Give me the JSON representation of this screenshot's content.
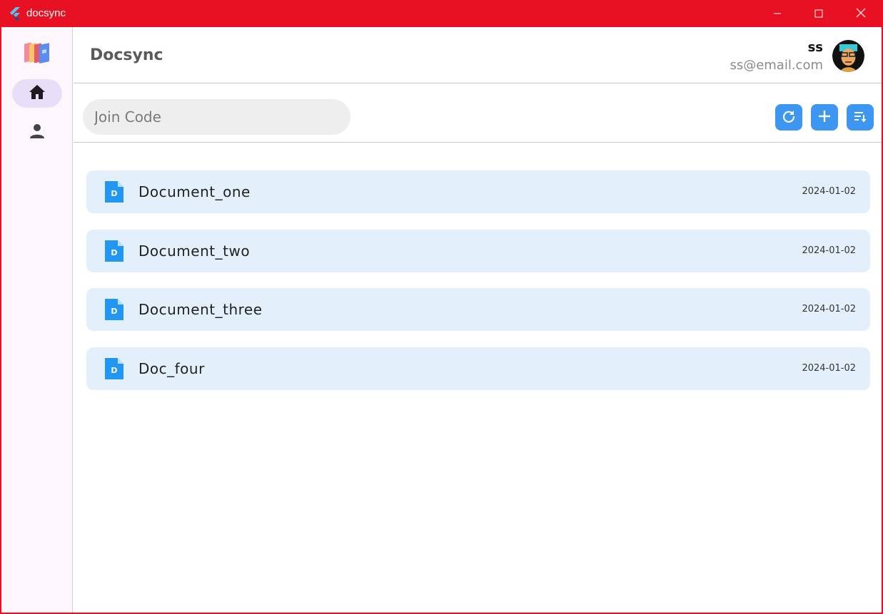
{
  "window": {
    "title": "docsync",
    "controls": {
      "minimize_icon": "minimize-icon",
      "maximize_icon": "maximize-icon",
      "close_icon": "close-icon"
    },
    "accent": "#e81123"
  },
  "rail": {
    "logo_icon": "folders-logo-icon",
    "items": [
      {
        "icon": "home-icon",
        "selected": true
      },
      {
        "icon": "person-icon",
        "selected": false
      }
    ],
    "selected_bg": "#e8def8"
  },
  "header": {
    "title": "Docsync",
    "user_name": "ss",
    "user_email": "ss@email.com",
    "avatar_icon": "avatar"
  },
  "toolbar": {
    "join_placeholder": "Join Code",
    "join_value": "",
    "buttons": [
      {
        "icon": "refresh-icon"
      },
      {
        "icon": "add-icon"
      },
      {
        "icon": "sort-icon"
      }
    ],
    "button_color": "#3d97f0"
  },
  "documents": [
    {
      "name": "Document_one",
      "date": "2024-01-02",
      "icon": "document-icon"
    },
    {
      "name": "Document_two",
      "date": "2024-01-02",
      "icon": "document-icon"
    },
    {
      "name": "Document_three",
      "date": "2024-01-02",
      "icon": "document-icon"
    },
    {
      "name": "Doc_four",
      "date": "2024-01-02",
      "icon": "document-icon"
    }
  ],
  "colors": {
    "card_bg": "#e3f0fc",
    "doc_icon": "#2196f3"
  }
}
